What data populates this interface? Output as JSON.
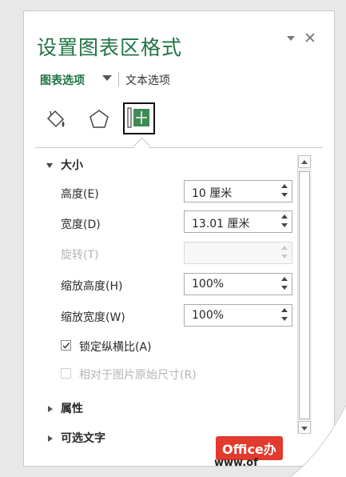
{
  "pane": {
    "title": "设置图表区格式",
    "tabs": {
      "active": "图表选项",
      "other": "文本选项"
    },
    "icons": [
      "fill-line-icon",
      "effects-pentagon-icon",
      "size-properties-icon"
    ],
    "accent_color": "#217346"
  },
  "size_section": {
    "header": "大小",
    "rows": [
      {
        "label": "高度(E)",
        "value": "10 厘米",
        "enabled": true
      },
      {
        "label": "宽度(D)",
        "value": "13.01 厘米",
        "enabled": true
      },
      {
        "label": "旋转(T)",
        "value": "",
        "enabled": false
      },
      {
        "label": "缩放高度(H)",
        "value": "100%",
        "enabled": true
      },
      {
        "label": "缩放宽度(W)",
        "value": "100%",
        "enabled": true
      }
    ],
    "lock_aspect": {
      "label": "锁定纵横比(A)",
      "checked": true
    },
    "relative_original": {
      "label": "相对于图片原始尺寸(R)",
      "checked": false,
      "enabled": false
    }
  },
  "collapsed_sections": [
    "属性",
    "可选文字"
  ],
  "watermark": {
    "badge": "Office办",
    "url": "www.of"
  }
}
